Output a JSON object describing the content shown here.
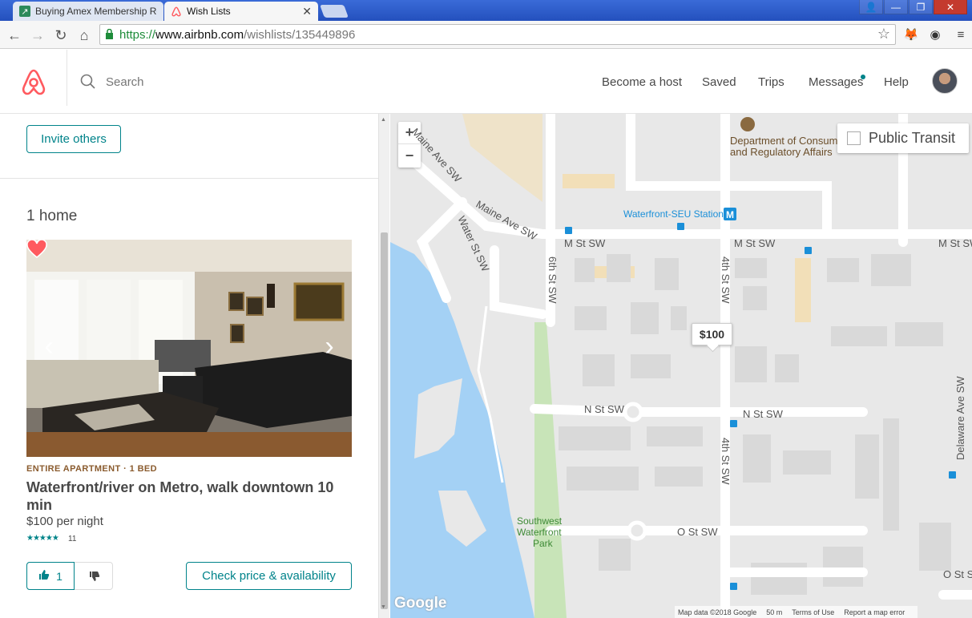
{
  "browser": {
    "tabs": [
      {
        "title": "Buying Amex Membership Re",
        "active": false
      },
      {
        "title": "Wish Lists",
        "active": true
      }
    ],
    "url": {
      "protocol": "https://",
      "host": "www.airbnb.com",
      "path": "/wishlists/135449896"
    }
  },
  "header": {
    "search_placeholder": "Search",
    "nav": [
      "Become a host",
      "Saved",
      "Trips",
      "Messages",
      "Help"
    ]
  },
  "wishlist": {
    "invite_label": "Invite others",
    "homes_count": "1 home",
    "listing": {
      "type": "ENTIRE APARTMENT · 1 BED",
      "title": "Waterfront/river on Metro, walk downtown 10 min",
      "price": "$100 per night",
      "stars": "★★★★★",
      "rating": 4.5,
      "reviews": "11",
      "upvotes": "1",
      "check_label": "Check price & availability"
    }
  },
  "map": {
    "zoom_in": "+",
    "zoom_out": "−",
    "transit_label": "Public Transit",
    "price_pin": "$100",
    "labels": {
      "maine_ave_1": "Maine Ave SW",
      "maine_ave_2": "Maine Ave SW",
      "water_st": "Water St SW",
      "m_st_1": "M St SW",
      "m_st_2": "M St SW",
      "m_st_3": "M St SW",
      "sixth_st": "6th St SW",
      "fourth_st_1": "4th St SW",
      "fourth_st_2": "4th St SW",
      "n_st_1": "N St SW",
      "n_st_2": "N St SW",
      "o_st_1": "O St SW",
      "o_st_2": "O St SW",
      "delaware": "Delaware Ave SW",
      "dept": "Department of Consum",
      "dept2": "and Regulatory Affairs",
      "station": "Waterfront-SEU Station",
      "park": "Southwest",
      "park2": "Waterfront",
      "park3": "Park"
    },
    "google": "Google",
    "attribution": [
      "Map data ©2018 Google",
      "50 m",
      "Terms of Use",
      "Report a map error"
    ],
    "colors": {
      "water": "#a4d1f5",
      "park": "#c8e4b8",
      "road": "#ffffff",
      "land": "#e8e8e8"
    }
  }
}
